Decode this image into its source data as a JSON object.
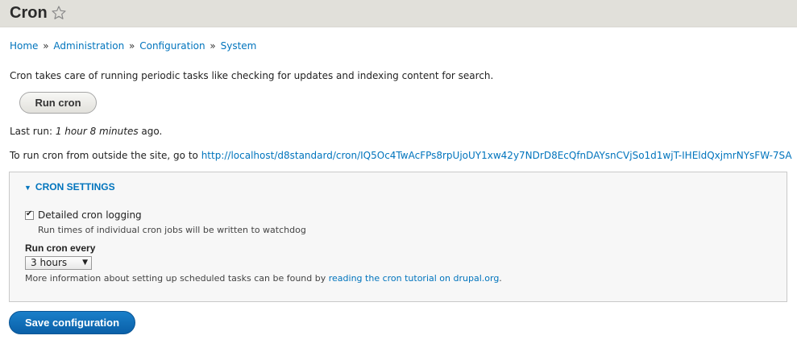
{
  "header": {
    "title": "Cron",
    "shortcut_icon": "star-outline-icon"
  },
  "breadcrumb": {
    "items": [
      "Home",
      "Administration",
      "Configuration",
      "System"
    ],
    "separator": "»"
  },
  "description": "Cron takes care of running periodic tasks like checking for updates and indexing content for search.",
  "run_button": {
    "label": "Run cron"
  },
  "last_run": {
    "prefix": "Last run: ",
    "value": "1 hour 8 minutes",
    "suffix": " ago."
  },
  "external": {
    "prefix": "To run cron from outside the site, go to ",
    "url": "http://localhost/d8standard/cron/IQ5Oc4TwAcFPs8rpUjoUY1xw42y7NDrD8EcQfnDAYsnCVjSo1d1wjT-IHEldQxjmrNYsFW-7SA"
  },
  "cron_settings": {
    "summary": "CRON SETTINGS",
    "summary_icon": "triangle-down-icon",
    "logging": {
      "label": "Detailed cron logging",
      "checked": true,
      "help": "Run times of individual cron jobs will be written to watchdog"
    },
    "run_every": {
      "label": "Run cron every",
      "selected": "3 hours"
    },
    "more_info": {
      "prefix": "More information about setting up scheduled tasks can be found by ",
      "link": "reading the cron tutorial on drupal.org",
      "suffix": "."
    }
  },
  "save_button": {
    "label": "Save configuration"
  },
  "colors": {
    "link": "#0074bd",
    "header_bg": "#e1e0da",
    "primary_button": "#0a6cb8"
  }
}
